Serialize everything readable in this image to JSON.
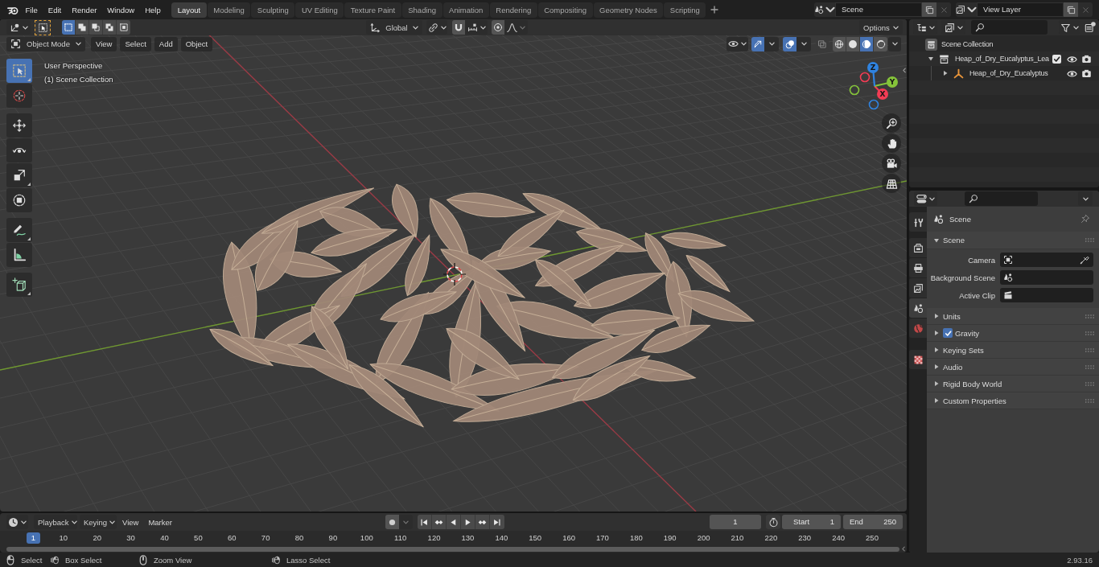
{
  "top_bar": {
    "menus": [
      "File",
      "Edit",
      "Render",
      "Window",
      "Help"
    ],
    "workspaces": [
      {
        "label": "Layout",
        "selected": true
      },
      {
        "label": "Modeling",
        "selected": false
      },
      {
        "label": "Sculpting",
        "selected": false
      },
      {
        "label": "UV Editing",
        "selected": false
      },
      {
        "label": "Texture Paint",
        "selected": false
      },
      {
        "label": "Shading",
        "selected": false
      },
      {
        "label": "Animation",
        "selected": false
      },
      {
        "label": "Rendering",
        "selected": false
      },
      {
        "label": "Compositing",
        "selected": false
      },
      {
        "label": "Geometry Nodes",
        "selected": false
      },
      {
        "label": "Scripting",
        "selected": false
      }
    ],
    "scene": "Scene",
    "view_layer": "View Layer"
  },
  "tool_header": {
    "select_modes": [
      {
        "kind": "set",
        "selected": true
      },
      {
        "kind": "extend",
        "selected": false
      },
      {
        "kind": "subtract",
        "selected": false
      },
      {
        "kind": "difference",
        "selected": false
      },
      {
        "kind": "intersect",
        "selected": false
      }
    ],
    "orientation": "Global",
    "snap": {
      "on": false
    },
    "proportional": {
      "on": false
    },
    "options": "Options"
  },
  "viewport_header": {
    "mode": "Object Mode",
    "menus": [
      "View",
      "Select",
      "Add",
      "Object"
    ],
    "gizmos": {
      "on": true
    },
    "overlays": {
      "on": true
    },
    "xray": {
      "on": false
    },
    "shading": [
      {
        "kind": "wireframe",
        "selected": false
      },
      {
        "kind": "solid",
        "selected": false
      },
      {
        "kind": "material",
        "selected": true
      },
      {
        "kind": "rendered",
        "selected": false
      }
    ]
  },
  "viewport": {
    "info": [
      "User Perspective",
      "(1) Scene Collection"
    ],
    "tools": [
      {
        "kind": "select",
        "selected": true
      },
      {
        "kind": "cursor",
        "selected": false
      },
      {
        "kind": "move",
        "selected": false
      },
      {
        "kind": "rotate",
        "selected": false
      },
      {
        "kind": "scale",
        "selected": false
      },
      {
        "kind": "transform",
        "selected": false
      },
      {
        "kind": "annotate",
        "selected": false
      },
      {
        "kind": "measure",
        "selected": false
      },
      {
        "kind": "add_cube",
        "selected": false
      }
    ],
    "gizmo_axes": [
      {
        "kind": "x",
        "label": "X"
      },
      {
        "kind": "y",
        "label": "Y"
      },
      {
        "kind": "z",
        "label": "Z"
      }
    ]
  },
  "outliner": {
    "root": "Scene Collection",
    "items": [
      {
        "kind": "collection",
        "label": "Heap_of_Dry_Eucalyptus_Lea",
        "expanded": true,
        "checked": true,
        "visible": true,
        "renderable": true,
        "children": [
          {
            "kind": "empty",
            "label": "Heap_of_Dry_Eucalyptus",
            "expanded": false,
            "visible": true,
            "renderable": true
          }
        ]
      }
    ]
  },
  "properties": {
    "tabs": [
      {
        "kind": "tool",
        "selected": false
      },
      {
        "kind": "render",
        "selected": false
      },
      {
        "kind": "output",
        "selected": false
      },
      {
        "kind": "view_layer",
        "selected": false
      },
      {
        "kind": "scene",
        "selected": true
      },
      {
        "kind": "world",
        "selected": false
      },
      {
        "kind": "texture",
        "selected": false
      }
    ],
    "context": "Scene",
    "panel": {
      "title": "Scene",
      "expanded": true,
      "fields": [
        {
          "kind": "camera",
          "label": "Camera"
        },
        {
          "kind": "scene",
          "label": "Background Scene"
        },
        {
          "kind": "clip",
          "label": "Active Clip"
        }
      ]
    },
    "sections": [
      {
        "kind": "plain",
        "label": "Units",
        "expanded": false
      },
      {
        "kind": "toggle",
        "label": "Gravity",
        "expanded": false,
        "checked": true
      },
      {
        "kind": "plain",
        "label": "Keying Sets",
        "expanded": false
      },
      {
        "kind": "plain",
        "label": "Audio",
        "expanded": false
      },
      {
        "kind": "plain",
        "label": "Rigid Body World",
        "expanded": false
      },
      {
        "kind": "plain",
        "label": "Custom Properties",
        "expanded": false
      }
    ]
  },
  "timeline": {
    "menus": [
      {
        "kind": "dropdown",
        "label": "Playback"
      },
      {
        "kind": "dropdown",
        "label": "Keying"
      },
      {
        "kind": "menu",
        "label": "View"
      },
      {
        "kind": "menu",
        "label": "Marker"
      }
    ],
    "auto_keying": {
      "on": false
    },
    "current_frame": "1",
    "start": {
      "label": "Start",
      "value": "1"
    },
    "end": {
      "label": "End",
      "value": "250"
    },
    "playhead": "1",
    "ruler": [
      "10",
      "20",
      "30",
      "40",
      "50",
      "60",
      "70",
      "80",
      "90",
      "100",
      "110",
      "120",
      "130",
      "140",
      "150",
      "160",
      "170",
      "180",
      "190",
      "200",
      "210",
      "220",
      "230",
      "240",
      "250"
    ]
  },
  "status_bar": {
    "hints": [
      {
        "kind": "left_click",
        "label": "Select"
      },
      {
        "kind": "left_drag",
        "label": "Box Select"
      },
      {
        "kind": "middle",
        "label": "Zoom View"
      },
      {
        "kind": "right_drag",
        "label": "Lasso Select"
      }
    ],
    "version": "2.93.16"
  }
}
